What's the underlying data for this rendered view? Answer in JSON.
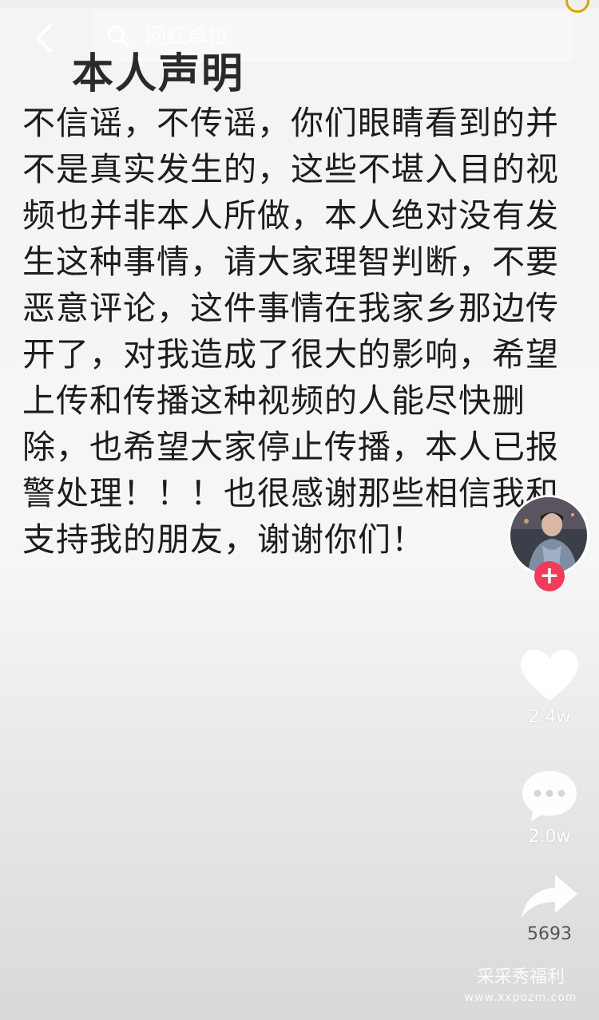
{
  "header": {
    "back_icon": "chevron-left-icon",
    "search_placeholder": "网红卓拉",
    "search_icon": "search-icon"
  },
  "content": {
    "title": "本人声明",
    "statement": "不信谣，不传谣，你们眼睛看到的并不是真实发生的，这些不堪入目的视频也并非本人所做，本人绝对没有发生这种事情，请大家理智判断，不要恶意评论，这件事情在我家乡那边传开了，对我造成了很大的影响，希望上传和传播这种视频的人能尽快删除，也希望大家停止传播，本人已报警处理！！！也很感谢那些相信我和支持我的朋友，谢谢你们！"
  },
  "sidebar": {
    "follow_label": "+",
    "likes": "2.4w",
    "comments": "2.0w",
    "shares": "5693"
  },
  "watermark": {
    "title": "采采秀福利",
    "url": "www.xxpozm.com"
  },
  "colors": {
    "follow_button": "#f23a5b",
    "title_text": "#2a2a2a",
    "body_text": "#1d1d1d"
  }
}
